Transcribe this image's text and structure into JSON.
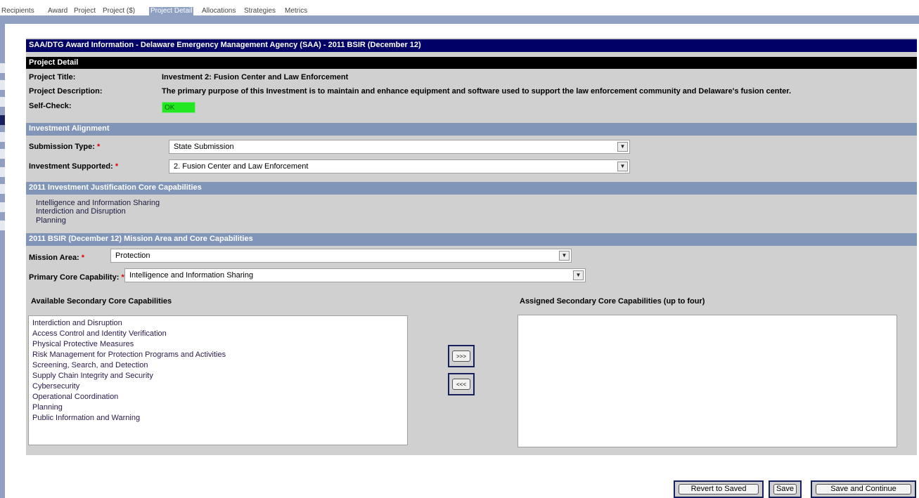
{
  "tabs": [
    {
      "label": "Recipients"
    },
    {
      "label": "Award"
    },
    {
      "label": "Project"
    },
    {
      "label": "Project ($)"
    },
    {
      "label": "Project Detail",
      "active": true
    },
    {
      "label": "Allocations"
    },
    {
      "label": "Strategies"
    },
    {
      "label": "Metrics"
    }
  ],
  "award_header": "SAA/DTG Award Information - Delaware Emergency Management Agency (SAA) - 2011 BSIR (December 12)",
  "project_detail": {
    "header": "Project Detail",
    "title_label": "Project Title:",
    "title_value": "Investment 2: Fusion Center and Law Enforcement",
    "description_label": "Project Description:",
    "description_value": "The primary purpose of this Investment is to maintain and enhance equipment and software used to support the law enforcement community and Delaware's fusion center.",
    "selfcheck_label": "Self-Check:",
    "selfcheck_value": "OK",
    "selfcheck_color": "#22e822"
  },
  "investment_alignment": {
    "header": "Investment Alignment",
    "submission_type_label": "Submission Type:",
    "submission_type_value": "State Submission",
    "investment_supported_label": "Investment Supported:",
    "investment_supported_value": "2. Fusion Center and Law Enforcement",
    "required_marker": "*"
  },
  "justification": {
    "header": "2011 Investment Justification Core Capabilities",
    "capabilities": [
      "Intelligence and Information Sharing",
      "Interdiction and Disruption",
      "Planning"
    ]
  },
  "mission": {
    "header": "2011 BSIR (December 12) Mission Area and Core Capabilities",
    "mission_area_label": "Mission Area:",
    "mission_area_value": "Protection",
    "primary_label": "Primary Core Capability:",
    "primary_value": "Intelligence and Information Sharing",
    "available_header": "Available Secondary Core Capabilities",
    "assigned_header": "Assigned Secondary Core Capabilities (up to four)",
    "available": [
      "Interdiction and Disruption",
      "Access Control and Identity Verification",
      "Physical Protective Measures",
      "Risk Management for Protection Programs and Activities",
      "Screening, Search, and Detection",
      "Supply Chain Integrity and Security",
      "Cybersecurity",
      "Operational Coordination",
      "Planning",
      "Public Information and Warning"
    ],
    "add_label": ">>>",
    "remove_label": "<<<"
  },
  "actions": {
    "revert_label": "Revert to Saved",
    "save_label": "Save",
    "save_continue_label": "Save and Continue"
  },
  "colors": {
    "navy": "#000066",
    "header_blue": "#8195b8",
    "panel_gray": "#d0d0d0",
    "required_red": "#dd0000"
  }
}
